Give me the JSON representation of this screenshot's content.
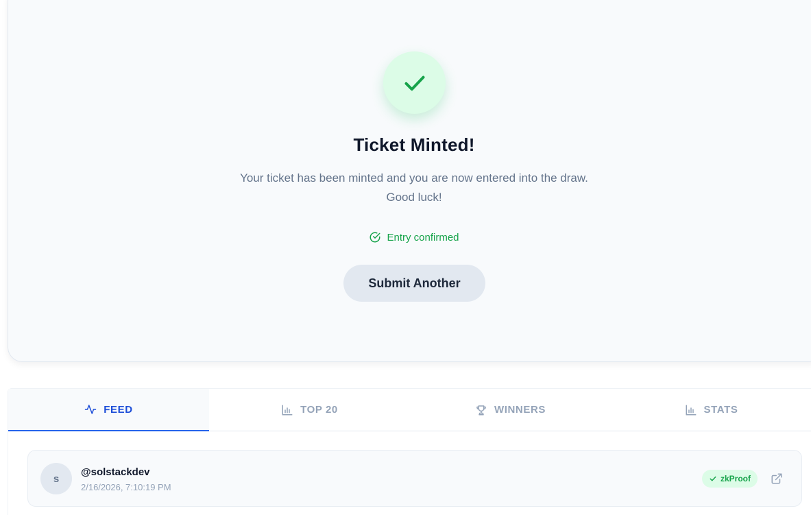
{
  "success": {
    "title": "Ticket Minted!",
    "message": "Your ticket has been minted and you are now entered into the draw. Good luck!",
    "status": "Entry confirmed",
    "submit_another_label": "Submit Another",
    "icon": "check-icon"
  },
  "tabs": [
    {
      "label": "FEED",
      "icon": "activity-icon",
      "active": true
    },
    {
      "label": "TOP 20",
      "icon": "bar-chart-icon",
      "active": false
    },
    {
      "label": "WINNERS",
      "icon": "trophy-icon",
      "active": false
    },
    {
      "label": "STATS",
      "icon": "bar-chart-icon",
      "active": false
    }
  ],
  "feed": {
    "items": [
      {
        "avatar_initial": "s",
        "username": "@solstackdev",
        "timestamp": "2/16/2026, 7:10:19 PM",
        "badge": "zkProof",
        "link_icon": "external-link-icon"
      }
    ]
  },
  "colors": {
    "success_green": "#16a34a",
    "success_bg": "#dcfce7",
    "active_tab": "#2563eb",
    "muted": "#94a3b8"
  }
}
